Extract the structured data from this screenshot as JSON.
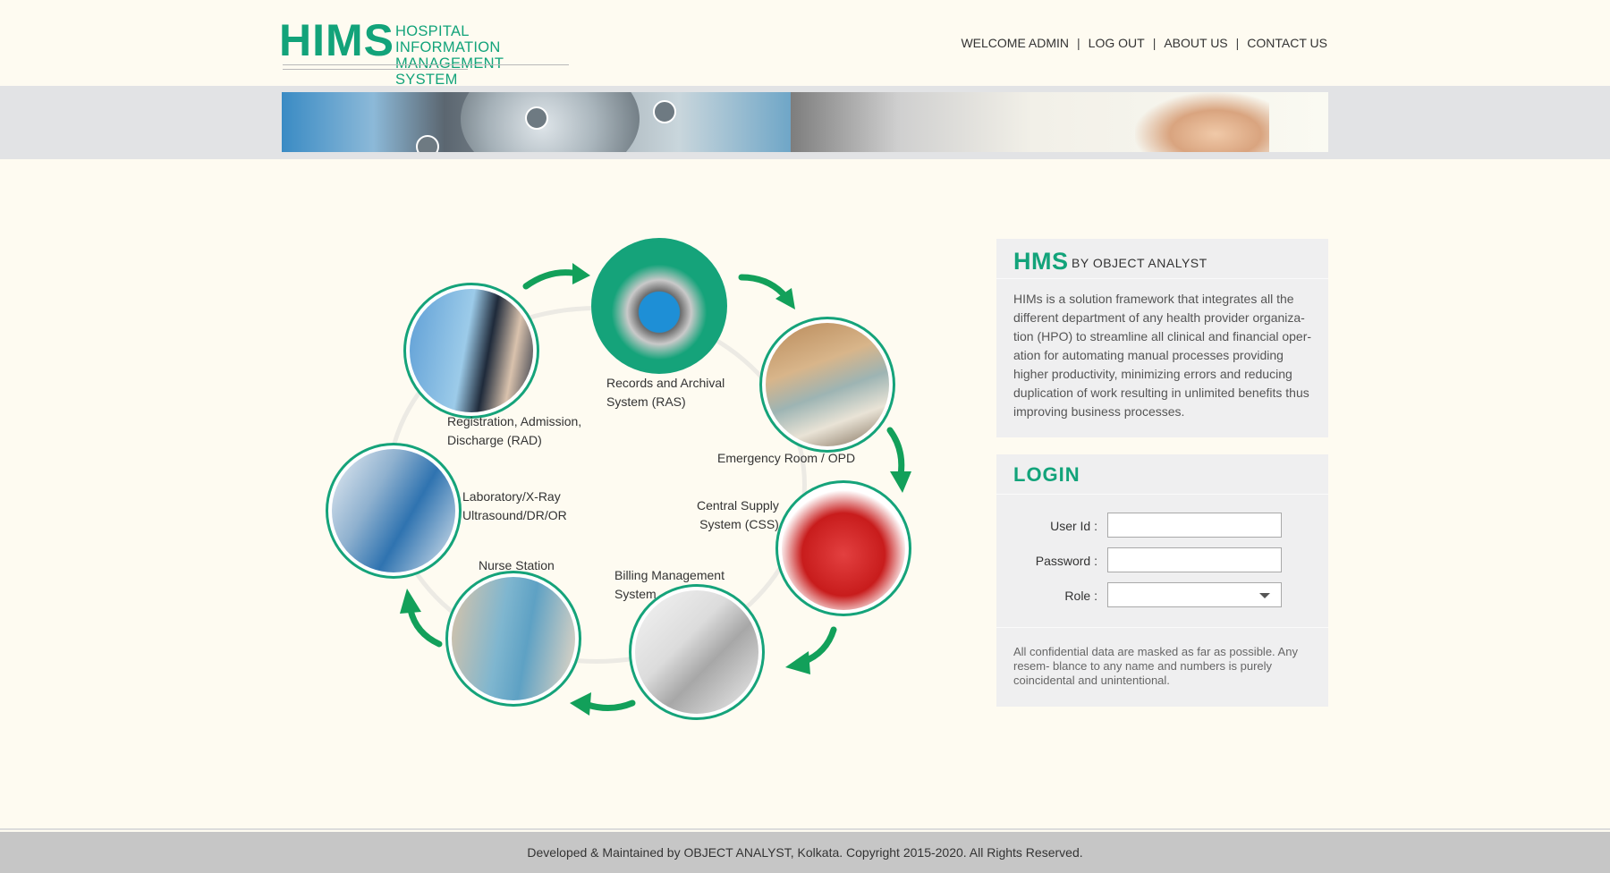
{
  "header": {
    "logo_main": "HIMS",
    "logo_sub_line1": "HOSPITAL INFORMATION",
    "logo_sub_line2": "MANAGEMENT SYSTEM",
    "nav": {
      "welcome": "WELCOME ADMIN",
      "logout": "LOG OUT",
      "about": "ABOUT US",
      "contact": "CONTACT US",
      "separator": "|"
    }
  },
  "diagram": {
    "nodes": [
      {
        "id": "ras",
        "label_line1": "Records and Archival",
        "label_line2": "System (RAS)"
      },
      {
        "id": "er",
        "label_line1": "Emergency Room / OPD",
        "label_line2": ""
      },
      {
        "id": "css",
        "label_line1": "Central Supply",
        "label_line2": "System (CSS)"
      },
      {
        "id": "billing",
        "label_line1": "Billing Management",
        "label_line2": "System"
      },
      {
        "id": "nurse",
        "label_line1": "Nurse Station",
        "label_line2": ""
      },
      {
        "id": "lab",
        "label_line1": "Laboratory/X-Ray",
        "label_line2": "Ultrasound/DR/OR"
      },
      {
        "id": "rad",
        "label_line1": "Registration, Admission,",
        "label_line2": "Discharge (RAD)"
      }
    ]
  },
  "about": {
    "title": "HMS",
    "byline": "BY OBJECT  ANALYST",
    "text": "HIMs is a solution framework that integrates all the different department of any health provider organiza- tion (HPO) to streamline all clinical and financial oper- ation for automating manual processes providing higher productivity, minimizing errors and reducing duplication of work resulting in unlimited benefits thus improving business processes."
  },
  "login": {
    "title": "LOGIN",
    "user_label": "User Id :",
    "user_value": "",
    "password_label": "Password :",
    "password_value": "",
    "role_label": "Role :",
    "role_value": "",
    "disclaimer": "All confidential data are masked as far as possible. Any resem- blance to any name and numbers is purely coincidental and unintentional."
  },
  "footer": {
    "text": "Developed & Maintained by OBJECT ANALYST, Kolkata. Copyright 2015-2020. All Rights Reserved."
  },
  "colors": {
    "brand_green": "#12a37a",
    "page_bg": "#fefbf1",
    "panel_bg": "#efeff0",
    "footer_bg": "#c6c6c6"
  }
}
